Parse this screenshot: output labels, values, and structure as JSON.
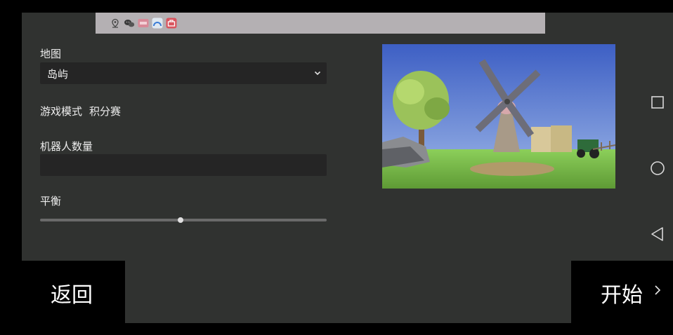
{
  "form": {
    "map_label": "地图",
    "map_value": "岛屿",
    "mode_label": "游戏模式",
    "mode_value": "积分赛",
    "bots_label": "机器人数量",
    "bots_value": "",
    "balance_label": "平衡",
    "balance_level": 0.49
  },
  "buttons": {
    "back_label": "返回",
    "start_label": "开始"
  },
  "statusbar": {
    "icons": [
      "location-icon",
      "wechat-icon",
      "app-badge-icon",
      "browser-icon",
      "toolbox-icon"
    ]
  },
  "navbar": {
    "icons": [
      "recents-square-icon",
      "home-circle-icon",
      "back-triangle-icon"
    ]
  },
  "colors": {
    "panel": "#303230",
    "field": "#252525",
    "statusbar": "#b4b0b3"
  }
}
